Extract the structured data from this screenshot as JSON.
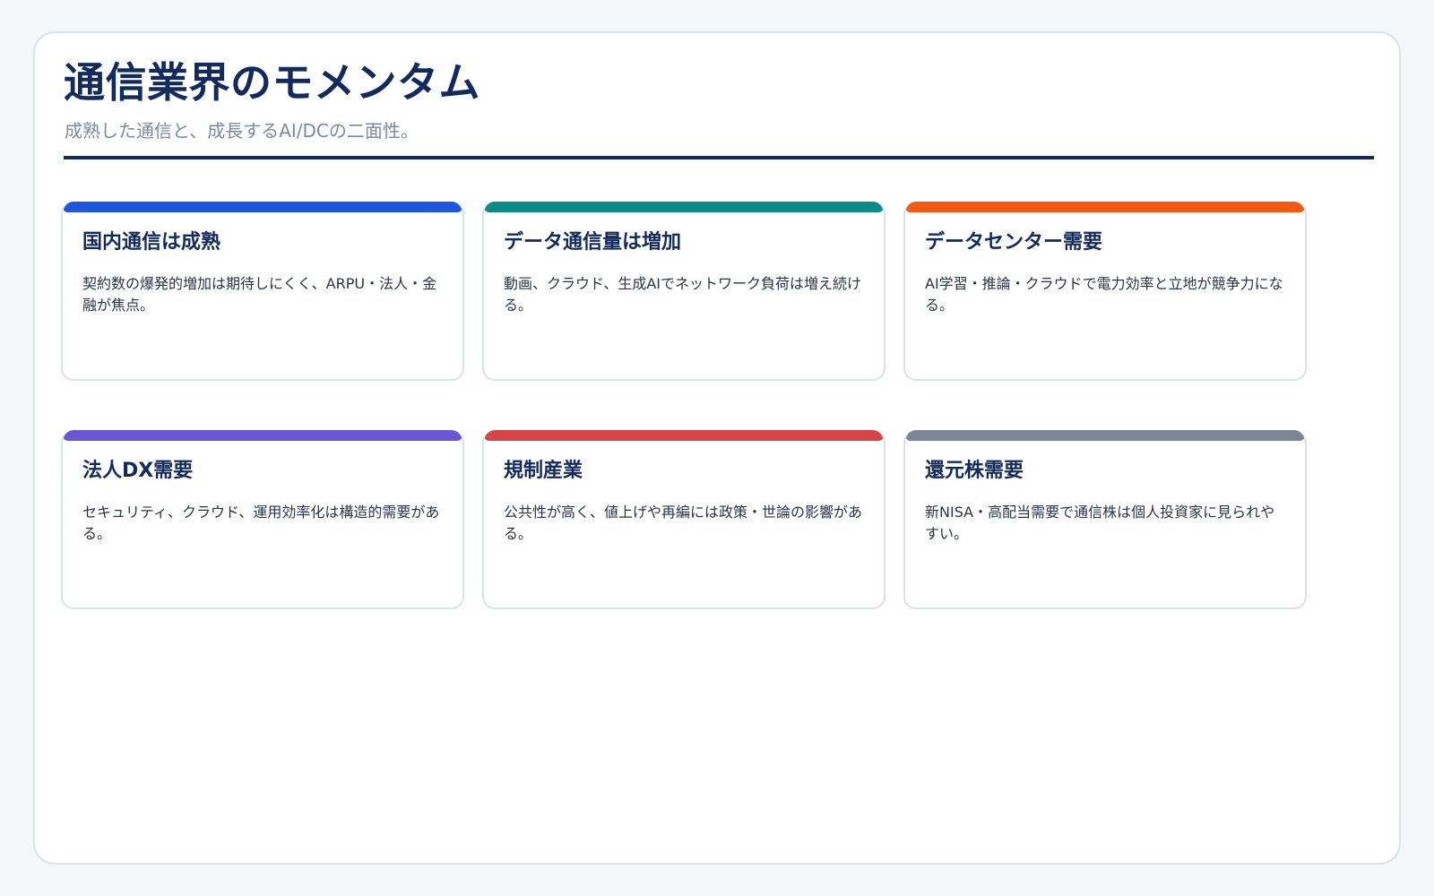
{
  "header": {
    "title": "通信業界のモメンタム",
    "subtitle": "成熟した通信と、成長するAI/DCの二面性。"
  },
  "cards": [
    {
      "title": "国内通信は成熟",
      "body": "契約数の爆発的増加は期待しにくく、ARPU・法人・金融が焦点。",
      "accent_color": "#1f56e0"
    },
    {
      "title": "データ通信量は増加",
      "body": "動画、クラウド、生成AIでネットワーク負荷は増え続ける。",
      "accent_color": "#0b8a8a"
    },
    {
      "title": "データセンター需要",
      "body": "AI学習・推論・クラウドで電力効率と立地が競争力になる。",
      "accent_color": "#f55a14"
    },
    {
      "title": "法人DX需要",
      "body": "セキュリティ、クラウド、運用効率化は構造的需要がある。",
      "accent_color": "#6b57d6"
    },
    {
      "title": "規制産業",
      "body": "公共性が高く、値上げや再編には政策・世論の影響がある。",
      "accent_color": "#d64545"
    },
    {
      "title": "還元株需要",
      "body": "新NISA・高配当需要で通信株は個人投資家に見られやすい。",
      "accent_color": "#7a8596"
    }
  ]
}
